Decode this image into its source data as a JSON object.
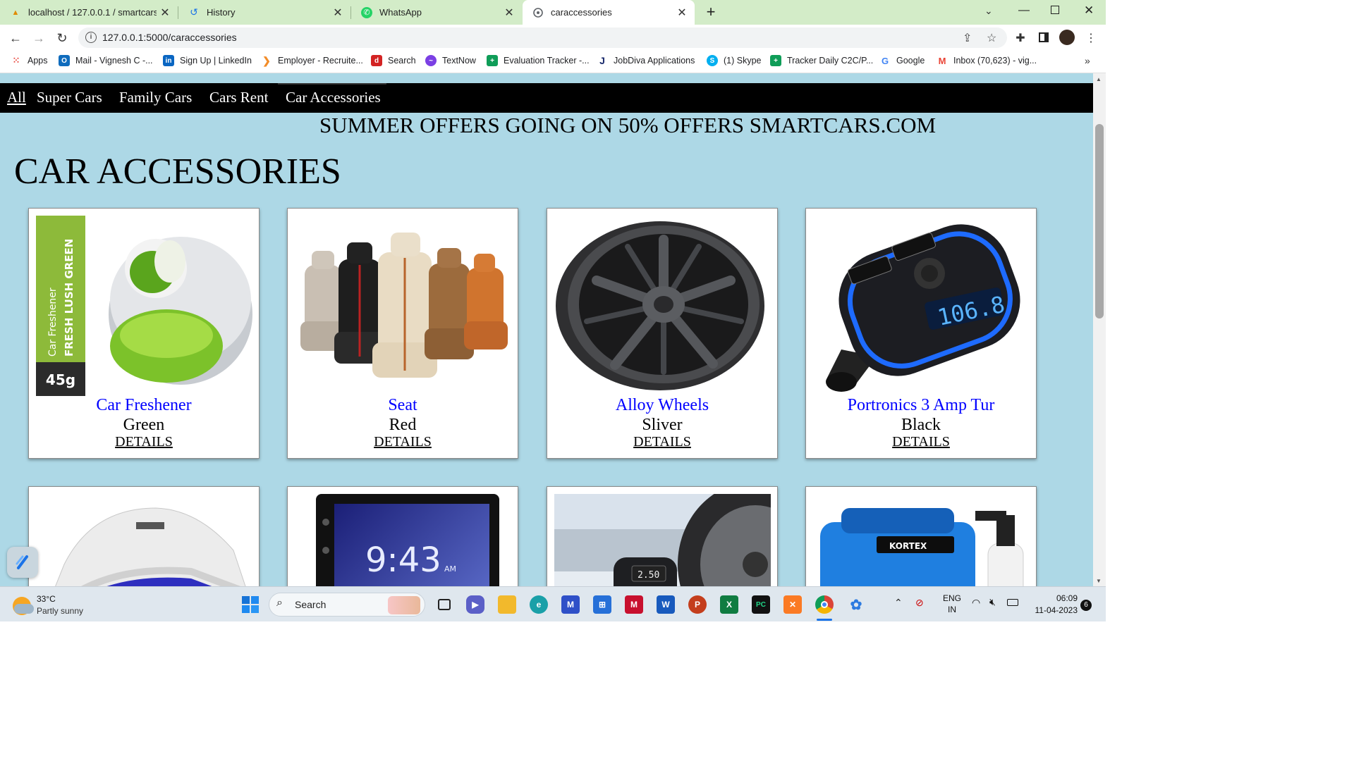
{
  "browser": {
    "tabs": [
      {
        "title": "localhost / 127.0.0.1 / smartcars |",
        "icon": "phpmyadmin-icon"
      },
      {
        "title": "History",
        "icon": "history-icon"
      },
      {
        "title": "WhatsApp",
        "icon": "whatsapp-icon"
      },
      {
        "title": "caraccessories",
        "icon": "globe-icon"
      }
    ],
    "url": "127.0.0.1:5000/caraccessories",
    "bookmarks": [
      {
        "label": "Apps"
      },
      {
        "label": "Mail - Vignesh C -..."
      },
      {
        "label": "Sign Up | LinkedIn"
      },
      {
        "label": "Employer - Recruite..."
      },
      {
        "label": "Search"
      },
      {
        "label": "TextNow"
      },
      {
        "label": "Evaluation Tracker -..."
      },
      {
        "label": "JobDiva Applications"
      },
      {
        "label": "(1) Skype"
      },
      {
        "label": "Tracker Daily C2C/P..."
      },
      {
        "label": "Google"
      },
      {
        "label": "Inbox (70,623) - vig..."
      }
    ]
  },
  "page": {
    "nav": [
      "All",
      "Super Cars",
      "Family Cars",
      "Cars Rent",
      "Car Accessories"
    ],
    "banner": "SUMMER OFFERS GOING ON 50% OFFERS SMARTCARS.COM",
    "title": "CAR ACCESSORIES",
    "products": [
      {
        "name": "Car Freshener",
        "color": "Green",
        "details": "DETAILS",
        "label_text": "Car Freshener FRESH LUSH GREEN",
        "weight": "45g"
      },
      {
        "name": "Seat",
        "color": "Red",
        "details": "DETAILS"
      },
      {
        "name": "Alloy Wheels",
        "color": "Sliver",
        "details": "DETAILS"
      },
      {
        "name": "Portronics 3 Amp Tur",
        "color": "Black",
        "details": "DETAILS",
        "display_text": "106.8"
      }
    ],
    "second_row": [
      {
        "image": "car-cover-image"
      },
      {
        "image": "car-stereo-image",
        "display_text": "9:43",
        "ampm": "AM"
      },
      {
        "image": "tyre-inflator-image",
        "display_text": "2.50"
      },
      {
        "image": "pressure-washer-image",
        "brand": "KORTEX"
      }
    ]
  },
  "taskbar": {
    "weather_temp": "33°C",
    "weather_desc": "Partly sunny",
    "search_placeholder": "Search",
    "lang_1": "ENG",
    "lang_2": "IN",
    "time": "06:09",
    "date": "11-04-2023",
    "notification_count": "6"
  }
}
